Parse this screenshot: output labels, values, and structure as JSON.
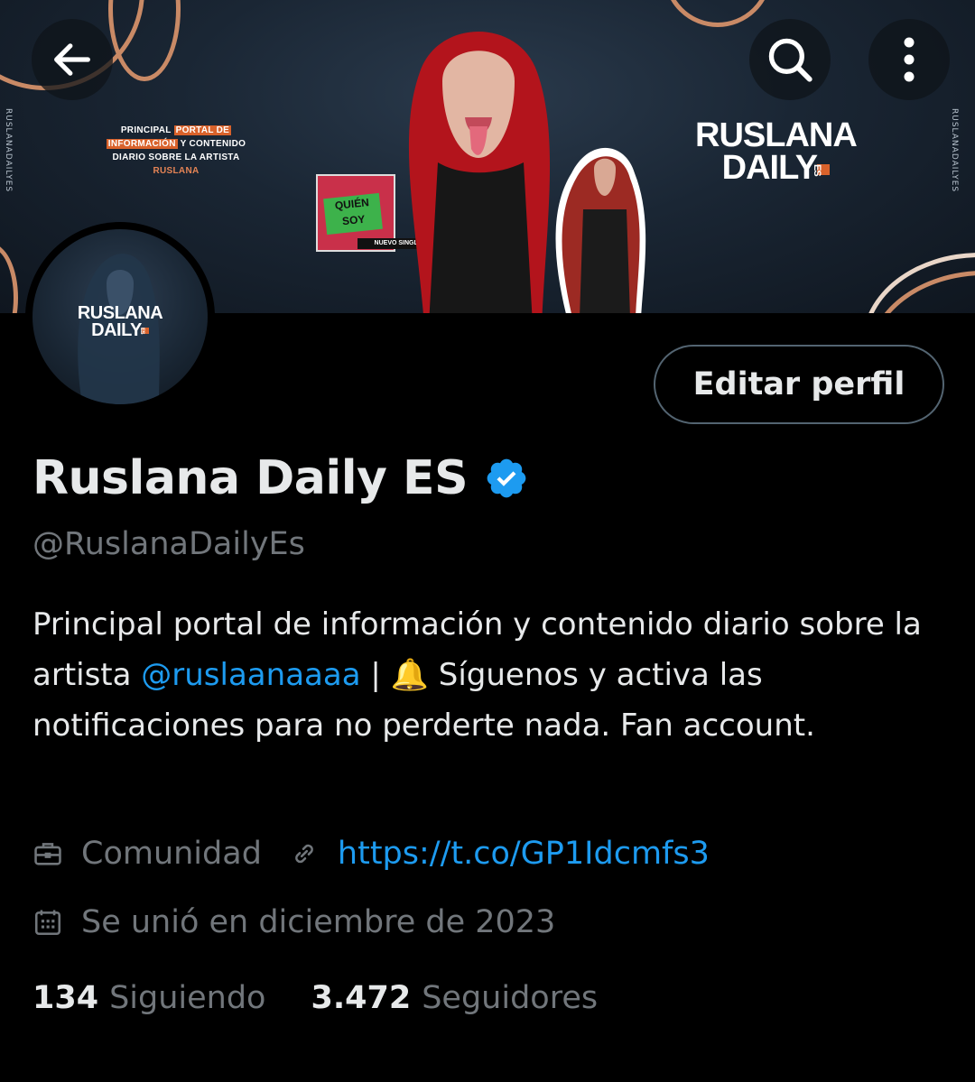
{
  "banner": {
    "side_handle": "RUSLANADAILYES",
    "portal_line1_pre": "PRINCIPAL",
    "portal_line1_hl": "PORTAL DE",
    "portal_line2_hl": "INFORMACIÓN",
    "portal_line2_post": "Y CONTENIDO",
    "portal_line3": "DIARIO SOBRE LA ARTISTA",
    "portal_line4": "RUSLANA",
    "logo_line1": "RUSLANA",
    "logo_line2": "DAILY",
    "logo_es": "ES",
    "single_title_1": "QUIÉN",
    "single_title_2": "SOY",
    "single_tag": "NUEVO SINGLE"
  },
  "header": {
    "back_icon": "arrow-left-icon",
    "search_icon": "search-icon",
    "more_icon": "more-vertical-icon"
  },
  "avatar": {
    "logo_line1": "RUSLANA",
    "logo_line2": "DAILY",
    "logo_es": "ES"
  },
  "profile": {
    "edit_button_label": "Editar perfil",
    "display_name": "Ruslana Daily ES",
    "handle": "@RuslanaDailyEs",
    "bio_part1": "Principal portal de información y contenido diario sobre la artista ",
    "bio_mention": "@ruslaanaaaa",
    "bio_part2": " | 🔔 Síguenos y activa las notificaciones para no perderte nada. Fan account.",
    "category": "Comunidad",
    "link": "https://t.co/GP1Idcmfs3",
    "joined": "Se unió en diciembre de 2023",
    "following_count": "134",
    "following_label": "Siguiendo",
    "followers_count": "3.472",
    "followers_label": "Seguidores"
  },
  "colors": {
    "accent": "#1d9bf0",
    "secondary_text": "#71767b",
    "primary_text": "#e7e9ea",
    "banner_orange": "#d9622b"
  }
}
